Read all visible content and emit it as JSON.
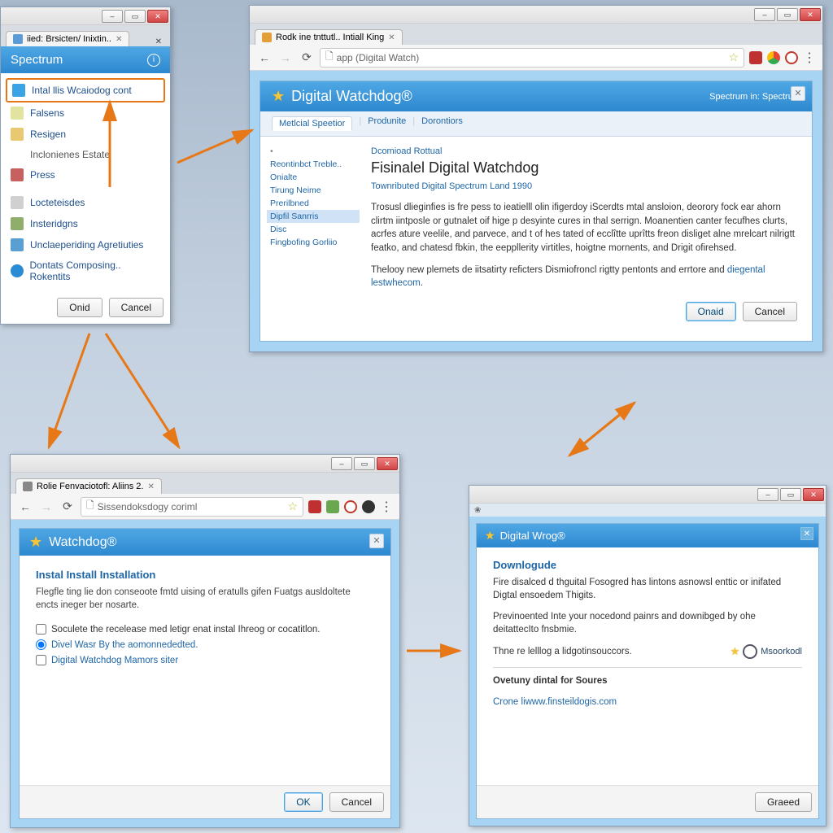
{
  "windowA": {
    "tab_title": "iied: Brsicten/ Inixtin..",
    "header": "Spectrum",
    "header_icon": "info-icon",
    "items": [
      {
        "label": "Intal llis Wcaiodog cont",
        "highlighted": true
      },
      {
        "label": "Falsens"
      },
      {
        "label": "Resigen"
      },
      {
        "label": "Inclonienes Estate"
      },
      {
        "label": "Press"
      },
      {
        "label": "Locteteisdes"
      },
      {
        "label": "Insteridgns"
      },
      {
        "label": "Unclaeperiding Agretiuties"
      },
      {
        "label": "Dontats Composing.. Rokentits"
      }
    ],
    "buttons": {
      "ok": "Onid",
      "cancel": "Cancel"
    }
  },
  "windowB": {
    "tab_title": "Rodk ine tnttutl.. Intiall King",
    "omnibox": "app (Digital Watch)",
    "header_title": "Digital Watchdog®",
    "header_right": "Spectrum in: Spectrum",
    "tabs": [
      "Metlcial Speetior",
      "Produnite",
      "Dorontiors"
    ],
    "side": [
      "Reontinbct Treble..",
      "Onialte",
      "Tirung Neime",
      "Prerilbned",
      "Dipfil Sanrris",
      "Disc",
      "Fingbofing Gorliio"
    ],
    "side_selected": 4,
    "main": {
      "pre_label": "Dcomioad Rottual",
      "h2": "Fisinalel Digital Watchdog",
      "sub_label": "Townributed Digital Spectrum Land 1990",
      "para1": "Trosusl dlieginfies is fre pess to ieatielll olin ifigerdoy iScerdts mtal ansloion, deorory fock ear ahorn clirtm iintposle or gutnalet oif hige p desyinte cures in thal serrign. Moanentien canter fecufhes clurts, acrfes ature veelile, and parvece, and t of hes tated of ecclîtte uprîtts freon disliget alne mrelcart nilrigtt featko, and chatesd fbkin, the eeppllerity virtitles, hoigtne mornents, and Drigit ofirehsed.",
      "para2_a": "Thelooy new plemets de iitsatirty reficters Dismiofroncl rigtty pentonts and errtore and ",
      "para2_link": "diegental lestwhecom",
      "buttons": {
        "ok": "Onaid",
        "cancel": "Cancel"
      }
    }
  },
  "windowC": {
    "tab_title": "Rolie Fenvaciotofl: Aliins 2.",
    "omnibox": "Sissendoksdogy coriml",
    "header_title": "Watchdog®",
    "section_title": "Instal Install Installation",
    "intro": "Flegfle ting lie don conseoote fmtd uising of eratulls gifen Fuatgs ausldoltete encts ineger ber nosarte.",
    "option1": "Soculete the recelease med letigr enat instal Ihreog or cocatitlon.",
    "radio": "Divel Wasr By the aomonnededted.",
    "option2": "Digital Watchdog Mamors siter",
    "buttons": {
      "ok": "OK",
      "cancel": "Cancel"
    }
  },
  "windowD": {
    "header_title": "Digital Wrog®",
    "section_title": "Downlogude",
    "para1": "Fire disalced d thguital Fosogred has lintons asnowsl enttic or inifated Digtal ensoedem Thigits.",
    "para2": "Previnoented Inte your nocedond painrs and downibged by ohe deitattecIto fnsbmie.",
    "para3": "Thne re lelllog a lidgotinsouccors.",
    "badge": "Msoorkodl",
    "section2_title": "Ovetuny dintal for Soures",
    "link": "Crone liwww.finsteildogis.com",
    "buttons": {
      "ok": "Graeed"
    }
  }
}
